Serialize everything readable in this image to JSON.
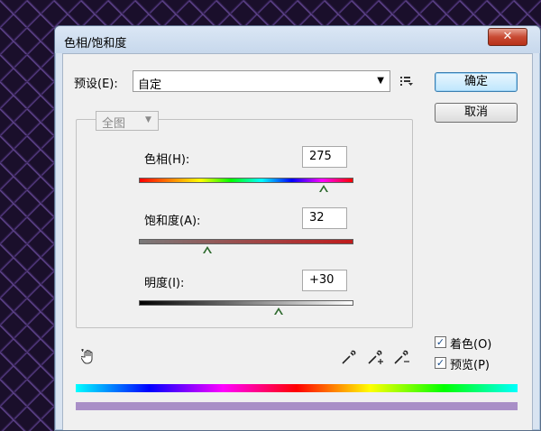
{
  "window": {
    "title": "色相/饱和度",
    "close_label": "✕"
  },
  "preset": {
    "label": "预设(E):",
    "value": "自定"
  },
  "buttons": {
    "ok": "确定",
    "cancel": "取消"
  },
  "channel": {
    "value": "全图"
  },
  "hue": {
    "label": "色相(H):",
    "value": "275",
    "position": 0.86
  },
  "saturation": {
    "label": "饱和度(A):",
    "value": "32",
    "position": 0.32
  },
  "lightness": {
    "label": "明度(I):",
    "value": "+30",
    "position": 0.65
  },
  "options": {
    "colorize": {
      "label": "着色(O)",
      "checked": true
    },
    "preview": {
      "label": "预览(P)",
      "checked": true
    }
  },
  "colors": {
    "accent": "#3c7fb1",
    "lower_bar": "#a98fc7",
    "thumb": "#2f6a2f"
  },
  "icons": [
    "preset-menu-icon",
    "hand-adjust-icon",
    "eyedropper-icon",
    "eyedropper-plus-icon",
    "eyedropper-minus-icon",
    "close-icon"
  ]
}
